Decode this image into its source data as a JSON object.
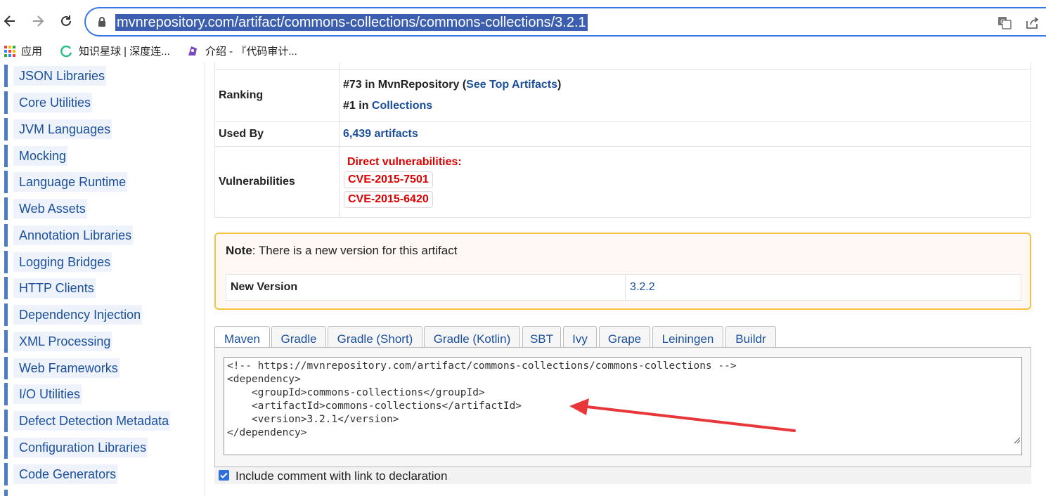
{
  "browser": {
    "url": "mvnrepository.com/artifact/commons-collections/commons-collections/3.2.1",
    "bookmarks": [
      {
        "label": "应用",
        "icon": "apps-grid-icon"
      },
      {
        "label": "知识星球 | 深度连...",
        "icon": "zsxq-icon"
      },
      {
        "label": "介绍 - 『代码审计...",
        "icon": "bookmark-icon"
      }
    ]
  },
  "sidebar": {
    "items": [
      {
        "label": "JSON Libraries"
      },
      {
        "label": "Core Utilities"
      },
      {
        "label": "JVM Languages"
      },
      {
        "label": "Mocking"
      },
      {
        "label": "Language Runtime"
      },
      {
        "label": "Web Assets"
      },
      {
        "label": "Annotation Libraries"
      },
      {
        "label": "Logging Bridges"
      },
      {
        "label": "HTTP Clients"
      },
      {
        "label": "Dependency Injection"
      },
      {
        "label": "XML Processing"
      },
      {
        "label": "Web Frameworks"
      },
      {
        "label": "I/O Utilities"
      },
      {
        "label": "Defect Detection Metadata"
      },
      {
        "label": "Configuration Libraries"
      },
      {
        "label": "Code Generators"
      }
    ]
  },
  "info": {
    "ranking_label": "Ranking",
    "ranking_line1_prefix": "#73 in MvnRepository (",
    "ranking_line1_link": "See Top Artifacts",
    "ranking_line1_suffix": ")",
    "ranking_line2_prefix": "#1 in ",
    "ranking_line2_link": "Collections",
    "used_by_label": "Used By",
    "used_by_value": "6,439 artifacts",
    "vuln_label": "Vulnerabilities",
    "vuln_heading": "Direct vulnerabilities:",
    "cves": [
      "CVE-2015-7501",
      "CVE-2015-6420"
    ]
  },
  "note": {
    "bold": "Note",
    "text": ": There is a new version for this artifact",
    "new_version_label": "New Version",
    "new_version_value": "3.2.2"
  },
  "tabs": [
    "Maven",
    "Gradle",
    "Gradle (Short)",
    "Gradle (Kotlin)",
    "SBT",
    "Ivy",
    "Grape",
    "Leiningen",
    "Buildr"
  ],
  "active_tab": "Maven",
  "code": "<!-- https://mvnrepository.com/artifact/commons-collections/commons-collections -->\n<dependency>\n    <groupId>commons-collections</groupId>\n    <artifactId>commons-collections</artifactId>\n    <version>3.2.1</version>\n</dependency>",
  "include_comment": {
    "label": "Include comment with link to declaration",
    "checked": true
  },
  "colors": {
    "link": "#1b4f9c",
    "danger": "#dd0000",
    "note_border": "#f5c242",
    "annotation_arrow": "#e8373a"
  }
}
